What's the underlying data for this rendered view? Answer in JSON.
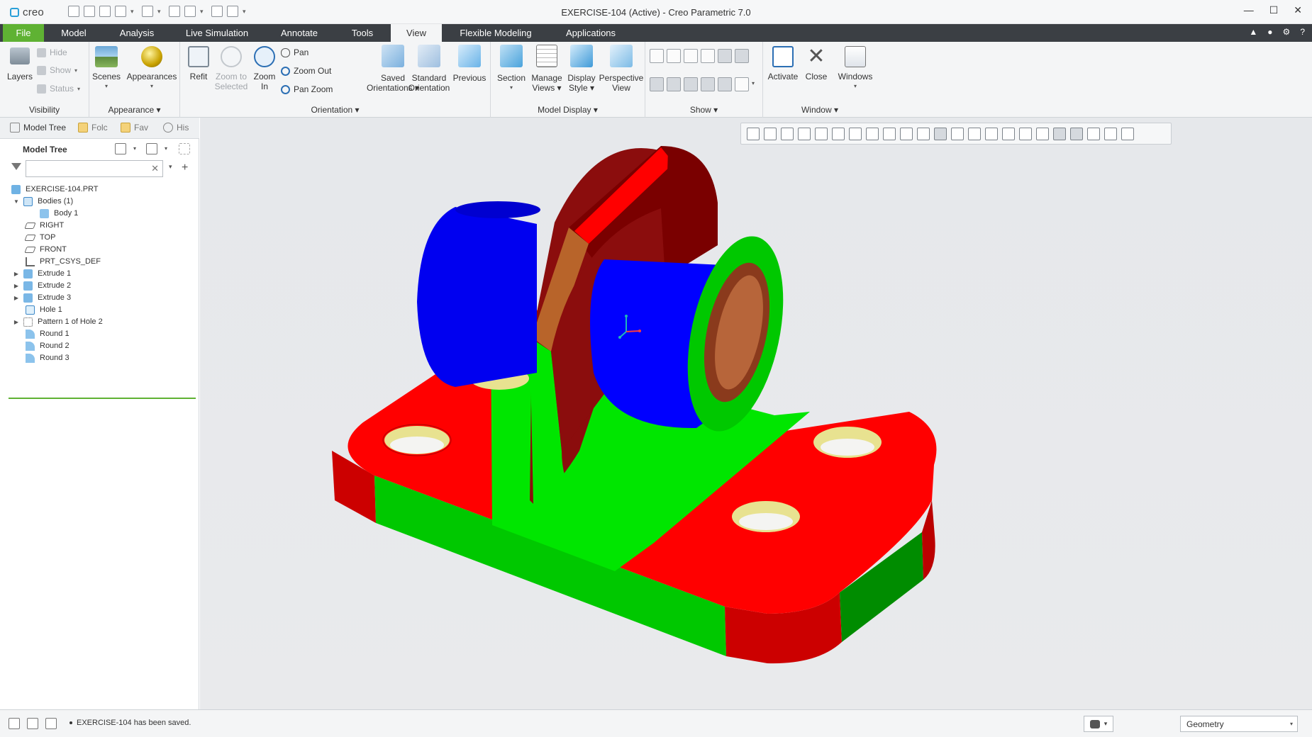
{
  "app": {
    "logo_text": "creo",
    "window_title": "EXERCISE-104 (Active) - Creo Parametric 7.0"
  },
  "window_controls": {
    "minimize": "—",
    "maximize": "☐",
    "close": "✕"
  },
  "tabs": [
    {
      "label": "File"
    },
    {
      "label": "Model"
    },
    {
      "label": "Analysis"
    },
    {
      "label": "Live Simulation"
    },
    {
      "label": "Annotate"
    },
    {
      "label": "Tools"
    },
    {
      "label": "View"
    },
    {
      "label": "Flexible Modeling"
    },
    {
      "label": "Applications"
    }
  ],
  "ribbon": {
    "visibility": {
      "label": "Visibility",
      "layers": "Layers",
      "hide": "Hide",
      "show": "Show",
      "status": "Status"
    },
    "appearance": {
      "label": "Appearance ▾",
      "scenes": "Scenes",
      "appearances": "Appearances"
    },
    "orientation": {
      "label": "Orientation ▾",
      "refit": "Refit",
      "zoom_to_selected_1": "Zoom to",
      "zoom_to_selected_2": "Selected",
      "zoom_in_1": "Zoom",
      "zoom_in_2": "In",
      "pan": "Pan",
      "zoom_out": "Zoom Out",
      "pan_zoom": "Pan Zoom",
      "saved_1": "Saved",
      "saved_2": "Orientations ▾",
      "standard_1": "Standard",
      "standard_2": "Orientation",
      "previous": "Previous"
    },
    "model_display": {
      "label": "Model Display ▾",
      "section": "Section",
      "manage_1": "Manage",
      "manage_2": "Views ▾",
      "display_1": "Display",
      "display_2": "Style ▾",
      "perspective_1": "Perspective",
      "perspective_2": "View"
    },
    "show": {
      "label": "Show ▾"
    },
    "window": {
      "label": "Window ▾",
      "activate": "Activate",
      "close": "Close",
      "windows": "Windows"
    }
  },
  "left_panel": {
    "tabs": [
      "Model Tree",
      "Folc",
      "Fav",
      "His"
    ],
    "title": "Model Tree",
    "search_placeholder": ""
  },
  "tree": [
    {
      "label": "EXERCISE-104.PRT"
    },
    {
      "label": "Bodies (1)"
    },
    {
      "label": "Body 1"
    },
    {
      "label": "RIGHT"
    },
    {
      "label": "TOP"
    },
    {
      "label": "FRONT"
    },
    {
      "label": "PRT_CSYS_DEF"
    },
    {
      "label": "Extrude 1"
    },
    {
      "label": "Extrude 2"
    },
    {
      "label": "Extrude 3"
    },
    {
      "label": "Hole 1"
    },
    {
      "label": "Pattern 1 of Hole 2"
    },
    {
      "label": "Round 1"
    },
    {
      "label": "Round 2"
    },
    {
      "label": "Round 3"
    }
  ],
  "status": {
    "message": "EXERCISE-104 has been saved.",
    "selection_filter": "Geometry"
  },
  "colors": {
    "model_red": "#ff0000",
    "model_green": "#00e600",
    "model_blue": "#0000ff",
    "model_brown": "#8b1a0c",
    "hole_yellow": "#e8e290",
    "accent_green": "#5fb233"
  }
}
